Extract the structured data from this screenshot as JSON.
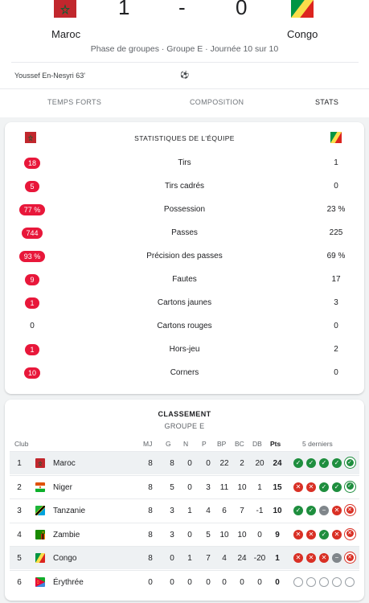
{
  "match": {
    "home": {
      "name": "Maroc",
      "score": "1"
    },
    "away": {
      "name": "Congo",
      "score": "0"
    },
    "separator": "-",
    "phase": "Phase de groupes · Groupe E · Journée 10 sur 10",
    "scorer": "Youssef En-Nesyri 63'",
    "ball_icon": "⚽"
  },
  "tabs": [
    {
      "label": "TEMPS FORTS",
      "active": false
    },
    {
      "label": "COMPOSITION",
      "active": false
    },
    {
      "label": "STATS",
      "active": true
    }
  ],
  "stats": {
    "title": "STATISTIQUES DE L'ÉQUIPE",
    "accent": "#e8173a",
    "rows": [
      {
        "label": "Tirs",
        "home": "18",
        "away": "1",
        "home_leads": true
      },
      {
        "label": "Tirs cadrés",
        "home": "5",
        "away": "0",
        "home_leads": true
      },
      {
        "label": "Possession",
        "home": "77 %",
        "away": "23 %",
        "home_leads": true
      },
      {
        "label": "Passes",
        "home": "744",
        "away": "225",
        "home_leads": true
      },
      {
        "label": "Précision des passes",
        "home": "93 %",
        "away": "69 %",
        "home_leads": true
      },
      {
        "label": "Fautes",
        "home": "9",
        "away": "17",
        "home_leads": true
      },
      {
        "label": "Cartons jaunes",
        "home": "1",
        "away": "3",
        "home_leads": true
      },
      {
        "label": "Cartons rouges",
        "home": "0",
        "away": "0",
        "home_leads": false
      },
      {
        "label": "Hors-jeu",
        "home": "1",
        "away": "2",
        "home_leads": true
      },
      {
        "label": "Corners",
        "home": "10",
        "away": "0",
        "home_leads": true
      }
    ]
  },
  "standings": {
    "title": "CLASSEMENT",
    "subtitle": "GROUPE E",
    "headers": {
      "club": "Club",
      "mj": "MJ",
      "g": "G",
      "n": "N",
      "p": "P",
      "bp": "BP",
      "bc": "BC",
      "db": "DB",
      "pts": "Pts",
      "last5": "5 derniers"
    },
    "rows": [
      {
        "pos": "1",
        "club": "Maroc",
        "flag": "morocco",
        "mj": "8",
        "g": "8",
        "n": "0",
        "p": "0",
        "bp": "22",
        "bc": "2",
        "db": "20",
        "pts": "24",
        "form": [
          "W",
          "W",
          "W",
          "W",
          "W"
        ],
        "highlight": true
      },
      {
        "pos": "2",
        "club": "Niger",
        "flag": "niger",
        "mj": "8",
        "g": "5",
        "n": "0",
        "p": "3",
        "bp": "11",
        "bc": "10",
        "db": "1",
        "pts": "15",
        "form": [
          "L",
          "L",
          "W",
          "W",
          "W"
        ],
        "highlight": false
      },
      {
        "pos": "3",
        "club": "Tanzanie",
        "flag": "tanzania",
        "mj": "8",
        "g": "3",
        "n": "1",
        "p": "4",
        "bp": "6",
        "bc": "7",
        "db": "-1",
        "pts": "10",
        "form": [
          "W",
          "W",
          "D",
          "L",
          "L"
        ],
        "highlight": false
      },
      {
        "pos": "4",
        "club": "Zambie",
        "flag": "zambia",
        "mj": "8",
        "g": "3",
        "n": "0",
        "p": "5",
        "bp": "10",
        "bc": "10",
        "db": "0",
        "pts": "9",
        "form": [
          "L",
          "L",
          "W",
          "L",
          "L"
        ],
        "highlight": false
      },
      {
        "pos": "5",
        "club": "Congo",
        "flag": "congo",
        "mj": "8",
        "g": "0",
        "n": "1",
        "p": "7",
        "bp": "4",
        "bc": "24",
        "db": "-20",
        "pts": "1",
        "form": [
          "L",
          "L",
          "L",
          "D",
          "L"
        ],
        "highlight": true
      },
      {
        "pos": "6",
        "club": "Érythrée",
        "flag": "eritrea",
        "mj": "0",
        "g": "0",
        "n": "0",
        "p": "0",
        "bp": "0",
        "bc": "0",
        "db": "0",
        "pts": "0",
        "form": [
          "N",
          "N",
          "N",
          "N",
          "N"
        ],
        "highlight": false
      }
    ]
  }
}
